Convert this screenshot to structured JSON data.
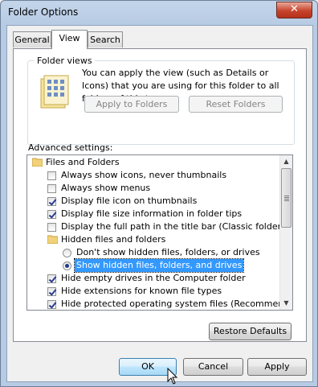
{
  "window": {
    "title": "Folder Options",
    "close_label": "✕"
  },
  "tabs": [
    {
      "label": "General"
    },
    {
      "label": "View"
    },
    {
      "label": "Search"
    }
  ],
  "folder_views": {
    "heading": "Folder views",
    "description": "You can apply the view (such as Details or Icons) that you are using for this folder to all folders of this type.",
    "apply_label": "Apply to Folders",
    "reset_label": "Reset Folders"
  },
  "advanced": {
    "heading": "Advanced settings:",
    "items": [
      {
        "kind": "folder",
        "label": "Files and Folders"
      },
      {
        "kind": "checkbox",
        "checked": false,
        "label": "Always show icons, never thumbnails"
      },
      {
        "kind": "checkbox",
        "checked": false,
        "label": "Always show menus"
      },
      {
        "kind": "checkbox",
        "checked": true,
        "label": "Display file icon on thumbnails"
      },
      {
        "kind": "checkbox",
        "checked": true,
        "label": "Display file size information in folder tips"
      },
      {
        "kind": "checkbox",
        "checked": false,
        "label": "Display the full path in the title bar (Classic folders only)"
      },
      {
        "kind": "folder",
        "label": "Hidden files and folders"
      },
      {
        "kind": "radio",
        "checked": false,
        "label": "Don't show hidden files, folders, or drives"
      },
      {
        "kind": "radio",
        "checked": true,
        "label": "Show hidden files, folders, and drives"
      },
      {
        "kind": "checkbox",
        "checked": true,
        "label": "Hide empty drives in the Computer folder"
      },
      {
        "kind": "checkbox",
        "checked": true,
        "label": "Hide extensions for known file types"
      },
      {
        "kind": "checkbox",
        "checked": true,
        "label": "Hide protected operating system files (Recommended)"
      }
    ],
    "restore_label": "Restore Defaults"
  },
  "footer": {
    "ok_label": "OK",
    "cancel_label": "Cancel",
    "apply_label": "Apply"
  }
}
